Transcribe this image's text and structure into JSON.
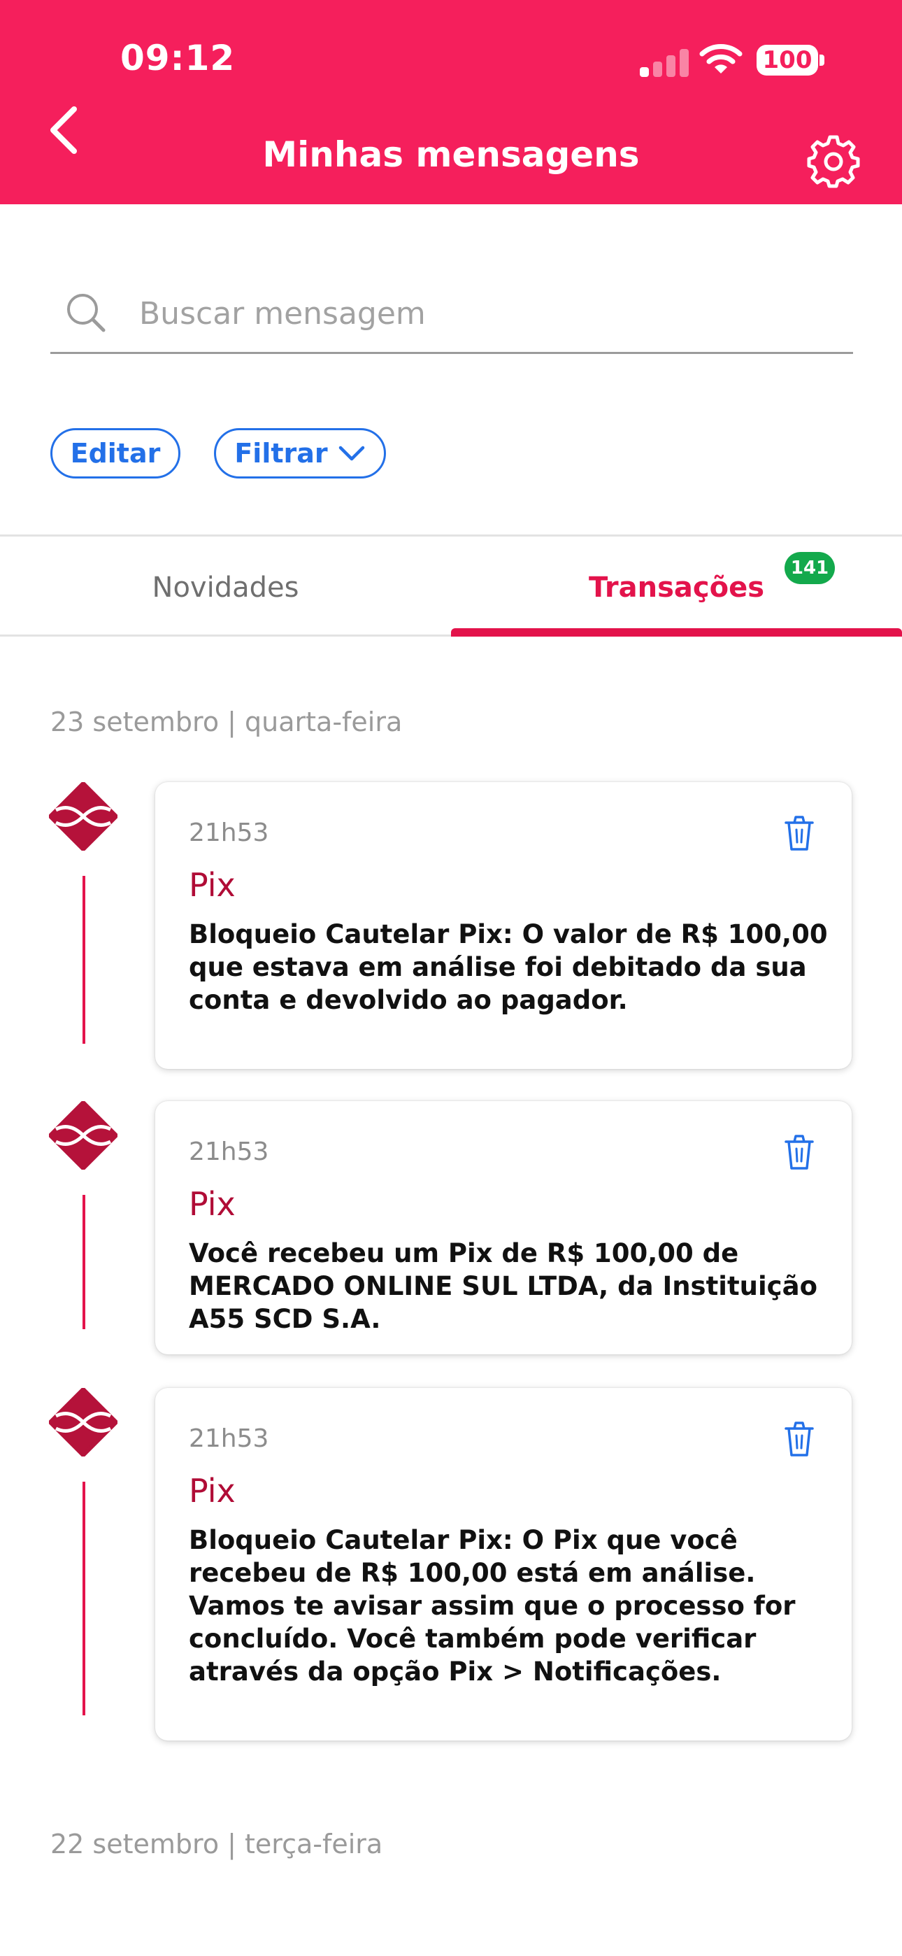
{
  "status_bar": {
    "time": "09:12",
    "battery": "100"
  },
  "header": {
    "title": "Minhas mensagens"
  },
  "search": {
    "placeholder": "Buscar mensagem"
  },
  "actions": {
    "edit_label": "Editar",
    "filter_label": "Filtrar"
  },
  "tabs": [
    {
      "label": "Novidades"
    },
    {
      "label": "Transações",
      "badge": "141"
    }
  ],
  "groups": [
    {
      "date": "23 setembro | quarta-feira",
      "messages": [
        {
          "time": "21h53",
          "title": "Pix",
          "text": "Bloqueio Cautelar Pix: O valor de R$ 100,00 que estava em análise foi debitado da sua conta e devolvido ao pagador."
        },
        {
          "time": "21h53",
          "title": "Pix",
          "text": "Você recebeu um Pix de R$ 100,00 de MERCADO ONLINE SUL LTDA, da Instituição A55 SCD S.A."
        },
        {
          "time": "21h53",
          "title": "Pix",
          "text": "Bloqueio Cautelar Pix: O Pix que você recebeu de R$ 100,00 está em análise. Vamos te avisar assim que o processo for concluído. Você também pode verificar através da opção Pix > Notificações."
        }
      ]
    },
    {
      "date": "22 setembro | terça-feira",
      "messages": []
    }
  ],
  "colors": {
    "header": "#f51f5c",
    "accent": "#e3134b",
    "link": "#2370e8",
    "badge": "#13a94c"
  },
  "icons": [
    "back-icon",
    "gear-icon",
    "search-icon",
    "chevron-down-icon",
    "pix-icon",
    "trash-icon"
  ]
}
